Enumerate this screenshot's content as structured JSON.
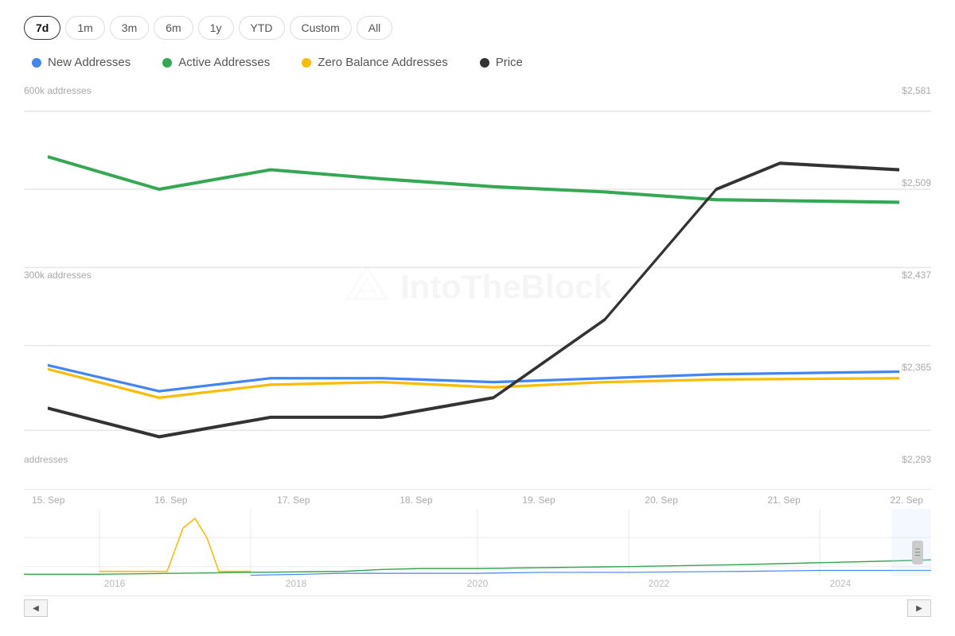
{
  "timeFilters": {
    "options": [
      "7d",
      "1m",
      "3m",
      "6m",
      "1y",
      "YTD",
      "Custom",
      "All"
    ],
    "active": "7d"
  },
  "legend": {
    "items": [
      {
        "label": "New Addresses",
        "color": "#4285f4",
        "id": "new-addresses"
      },
      {
        "label": "Active Addresses",
        "color": "#34a853",
        "id": "active-addresses"
      },
      {
        "label": "Zero Balance Addresses",
        "color": "#fbbc04",
        "id": "zero-balance"
      },
      {
        "label": "Price",
        "color": "#333333",
        "id": "price"
      }
    ]
  },
  "chart": {
    "yAxisLeft": [
      "600k addresses",
      "300k addresses",
      "addresses"
    ],
    "yAxisRight": [
      "$2,581",
      "$2,509",
      "$2,437",
      "$2,365",
      "$2,293"
    ],
    "xAxisLabels": [
      "15. Sep",
      "16. Sep",
      "17. Sep",
      "18. Sep",
      "19. Sep",
      "20. Sep",
      "21. Sep",
      "22. Sep"
    ]
  },
  "miniChart": {
    "yearLabels": [
      "2016",
      "2018",
      "2020",
      "2022",
      "2024"
    ]
  },
  "watermark": "IntoTheBlock"
}
